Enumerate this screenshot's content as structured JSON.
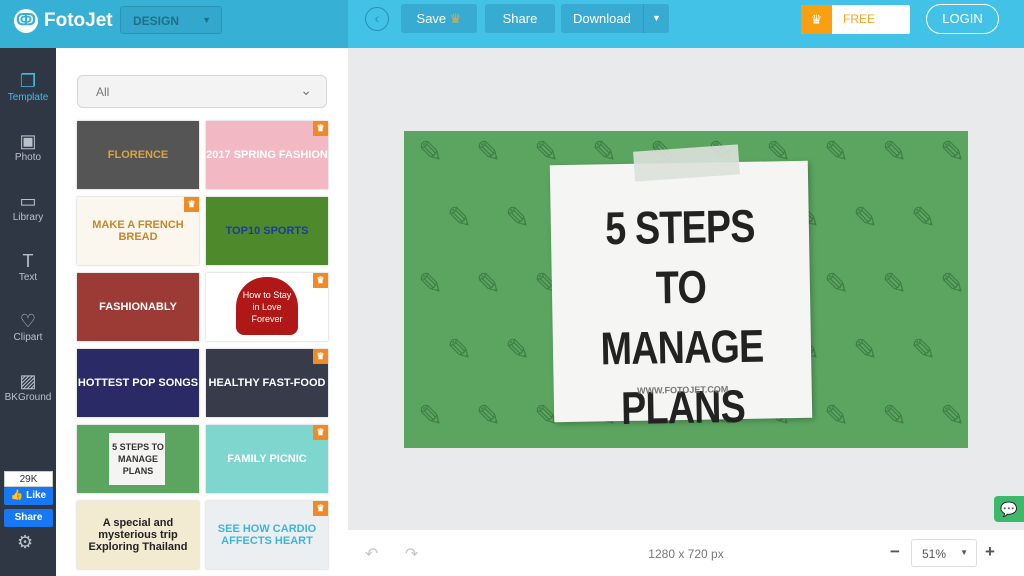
{
  "header": {
    "brand": "FotoJet",
    "mode_select": "DESIGN",
    "save": "Save",
    "share": "Share",
    "download": "Download",
    "free_trial": "FREE TRIAL",
    "login": "LOGIN"
  },
  "sidebar": {
    "items": [
      {
        "label": "Template",
        "icon": "template-icon"
      },
      {
        "label": "Photo",
        "icon": "photo-icon"
      },
      {
        "label": "Library",
        "icon": "library-icon"
      },
      {
        "label": "Text",
        "icon": "text-icon"
      },
      {
        "label": "Clipart",
        "icon": "heart-icon"
      },
      {
        "label": "BKGround",
        "icon": "background-icon"
      }
    ],
    "facebook": {
      "count": "29K",
      "like": "Like",
      "share": "Share"
    }
  },
  "panel": {
    "filter": "All",
    "templates": [
      {
        "text": "FLORENCE",
        "bg": "#555",
        "fg": "#d9a441",
        "premium": false
      },
      {
        "text": "2017 SPRING FASHION",
        "bg": "#f2b8c4",
        "fg": "#fff",
        "premium": true
      },
      {
        "text": "MAKE A FRENCH BREAD",
        "bg": "#fbf7ee",
        "fg": "#c8862a",
        "premium": true
      },
      {
        "text": "TOP10 SPORTS",
        "bg": "#4e8a2c",
        "fg": "#1d3c9c",
        "premium": false
      },
      {
        "text": "FASHIONABLY",
        "bg": "#9c3a35",
        "fg": "#fff",
        "premium": false
      },
      {
        "text": "How to Stay in Love Forever",
        "bg": "#fff",
        "fg": "#fff",
        "premium": true
      },
      {
        "text": "HOTTEST POP SONGS",
        "bg": "#2a2a66",
        "fg": "#fff",
        "premium": false
      },
      {
        "text": "HEALTHY FAST-FOOD",
        "bg": "#373b4a",
        "fg": "#fff",
        "premium": true
      },
      {
        "text": "5 STEPS TO MANAGE PLANS",
        "bg": "#5ba561",
        "fg": "#333",
        "premium": false
      },
      {
        "text": "FAMILY PICNIC",
        "bg": "#7fd6cf",
        "fg": "#fff",
        "premium": true
      },
      {
        "text": "A special and mysterious trip Exploring Thailand",
        "bg": "#f3ead2",
        "fg": "#222",
        "premium": false
      },
      {
        "text": "SEE HOW CARDIO AFFECTS HEART",
        "bg": "#eceff2",
        "fg": "#3bb6d8",
        "premium": true
      }
    ]
  },
  "canvas": {
    "title_lines": [
      "5 STEPS",
      "TO MANAGE",
      "PLANS"
    ],
    "url": "WWW.FOTOJET.COM",
    "bg": "#5ba561"
  },
  "footer": {
    "dimensions": "1280 x 720 px",
    "zoom": "51%"
  }
}
